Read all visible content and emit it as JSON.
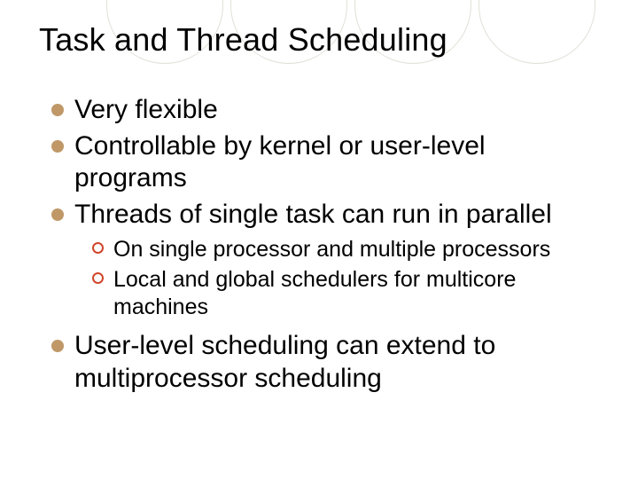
{
  "title": "Task and Thread Scheduling",
  "bullets": [
    {
      "text": "Very flexible"
    },
    {
      "text": "Controllable by kernel or user-level programs"
    },
    {
      "text": "Threads of single task can run in parallel",
      "sub": [
        {
          "text": "On single processor and multiple processors"
        },
        {
          "text": "Local and global schedulers for multicore machines"
        }
      ]
    },
    {
      "text": "User-level scheduling can extend to multiprocessor scheduling"
    }
  ],
  "bg_circle_positions": [
    60,
    200,
    340,
    480
  ]
}
